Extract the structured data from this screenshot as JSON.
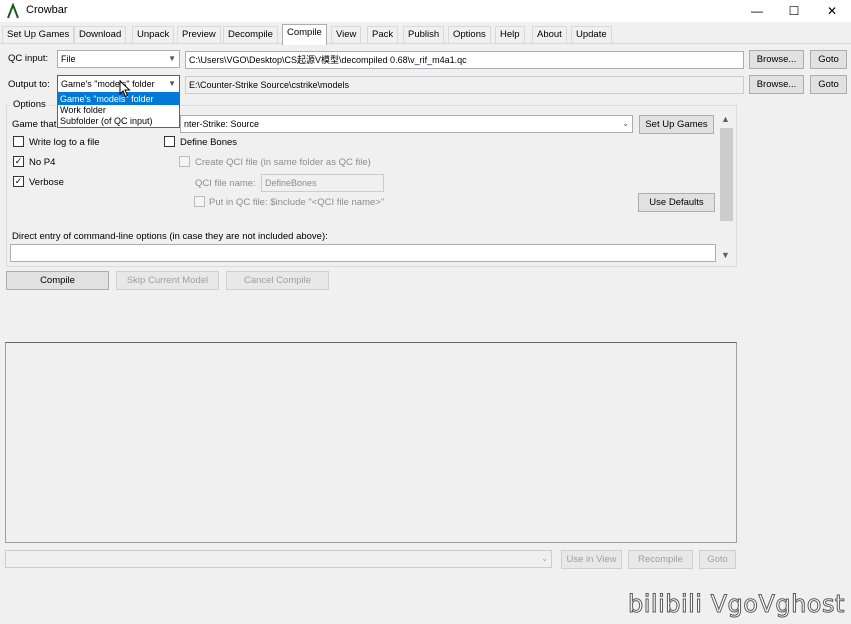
{
  "window": {
    "title": "Crowbar",
    "minimize_glyph": "—",
    "maximize_glyph": "☐",
    "close_glyph": "✕"
  },
  "tabs": [
    {
      "label": "Set Up Games"
    },
    {
      "label": "Download"
    },
    {
      "label": "Unpack"
    },
    {
      "label": "Preview"
    },
    {
      "label": "Decompile"
    },
    {
      "label": "Compile",
      "active": true
    },
    {
      "label": "View"
    },
    {
      "label": "Pack"
    },
    {
      "label": "Publish"
    },
    {
      "label": "Options"
    },
    {
      "label": "Help"
    },
    {
      "label": "About"
    },
    {
      "label": "Update"
    }
  ],
  "qc_input": {
    "label": "QC input:",
    "mode": "File",
    "path": "C:\\Users\\VGO\\Desktop\\CS起源V模型\\decompiled 0.68\\v_rif_m4a1.qc",
    "browse_label": "Browse...",
    "goto_label": "Goto"
  },
  "output_to": {
    "label": "Output to:",
    "mode": "Game's \"models\" folder",
    "path": "E:\\Counter-Strike Source\\cstrike\\models",
    "browse_label": "Browse...",
    "goto_label": "Goto",
    "dropdown_options": [
      "Game's \"models\" folder",
      "Work folder",
      "Subfolder (of QC input)"
    ]
  },
  "options": {
    "title": "Options",
    "game_label": "Game that",
    "game_value": "nter-Strike: Source",
    "setup_games_label": "Set Up Games",
    "write_log": {
      "label": "Write log to a file",
      "checked": false
    },
    "no_p4": {
      "label": "No P4",
      "checked": true
    },
    "verbose": {
      "label": "Verbose",
      "checked": true
    },
    "define_bones": {
      "label": "Define Bones",
      "checked": false
    },
    "create_qci": {
      "label": "Create QCI file (in same folder as QC file)",
      "checked": false
    },
    "qci_name_label": "QCI file name:",
    "qci_name_value": "DefineBones",
    "put_in_qc": {
      "label": "Put in QC file: $include \"<QCI file name>\"",
      "checked": false
    },
    "use_defaults_label": "Use Defaults",
    "direct_entry_label": "Direct entry of command-line options (in case they are not included above):",
    "direct_entry_value": ""
  },
  "actions": {
    "compile": "Compile",
    "skip": "Skip Current Model",
    "cancel": "Cancel Compile"
  },
  "bottom": {
    "use_in_view": "Use in View",
    "recompile": "Recompile",
    "goto": "Goto"
  },
  "watermark": "bilibili VgoVghost",
  "colors": {
    "selection": "#0078d7",
    "background": "#f0f0f0",
    "logo": "#3c8a3c"
  }
}
